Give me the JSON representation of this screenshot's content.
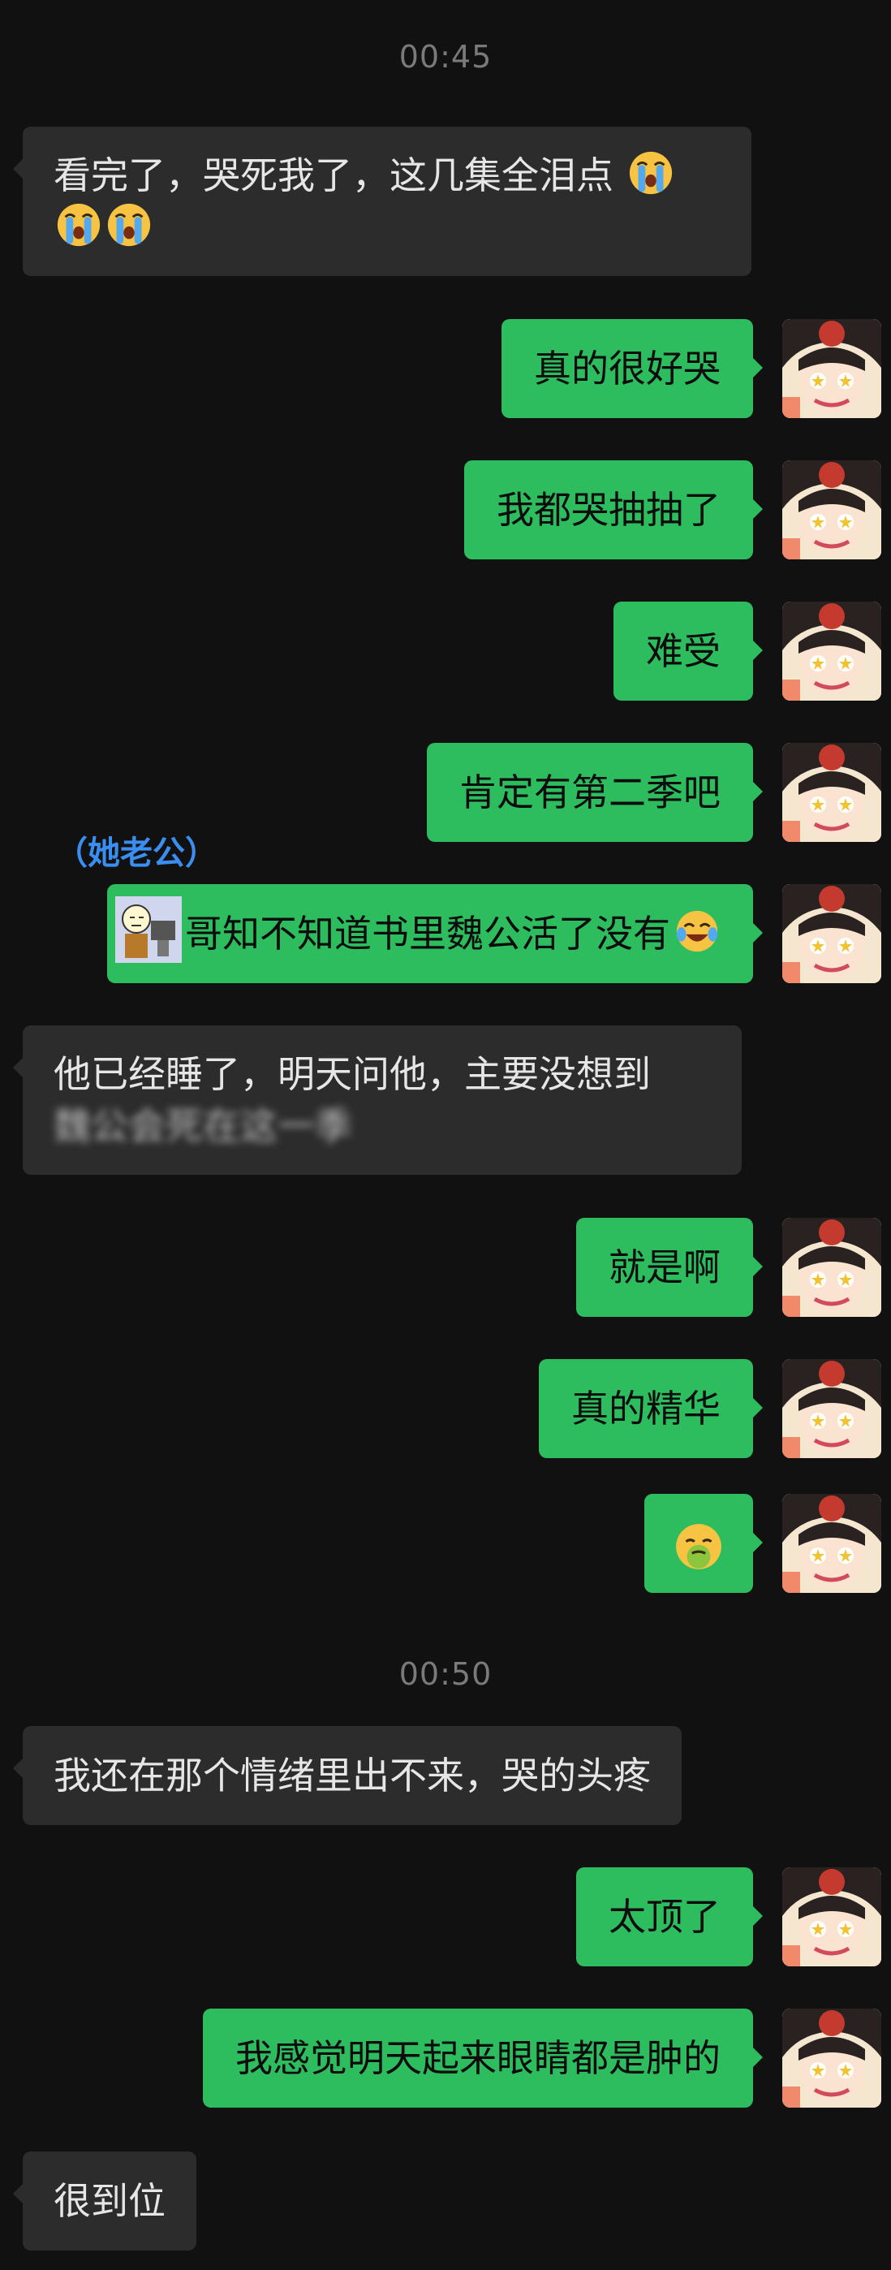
{
  "timestamps": {
    "first": "00:45",
    "second": "00:50"
  },
  "messages": {
    "m1_line1": "看完了，哭死我了，这几集全泪点",
    "m2": "真的很好哭",
    "m3": "我都哭抽抽了",
    "m4": "难受",
    "m5": "肯定有第二季吧",
    "m6_sender": "（她老公）",
    "m6": "哥知不知道书里魏公活了没有",
    "m7_line1": "他已经睡了，明天问他，主要没想到",
    "m7_line2_blurred": "魏公会死在这一季",
    "m8": "就是啊",
    "m9": "真的精华",
    "m10_emoji_name": "nauseated-face-emoji",
    "m11": "我还在那个情绪里出不来，哭的头疼",
    "m12": "太顶了",
    "m13": "我感觉明天起来眼睛都是肿的",
    "m14": "很到位"
  },
  "colors": {
    "background": "#111111",
    "incoming_bubble": "#2c2c2c",
    "outgoing_bubble": "#2dbd5f",
    "sender_tag": "#3a8ef0",
    "timestamp": "#7a7a7a"
  },
  "icons": {
    "cry": "loudly-crying-face-emoji",
    "tears_of_joy": "rolling-on-floor-laughing-emoji",
    "avatar": "anime-girl-avatar"
  }
}
